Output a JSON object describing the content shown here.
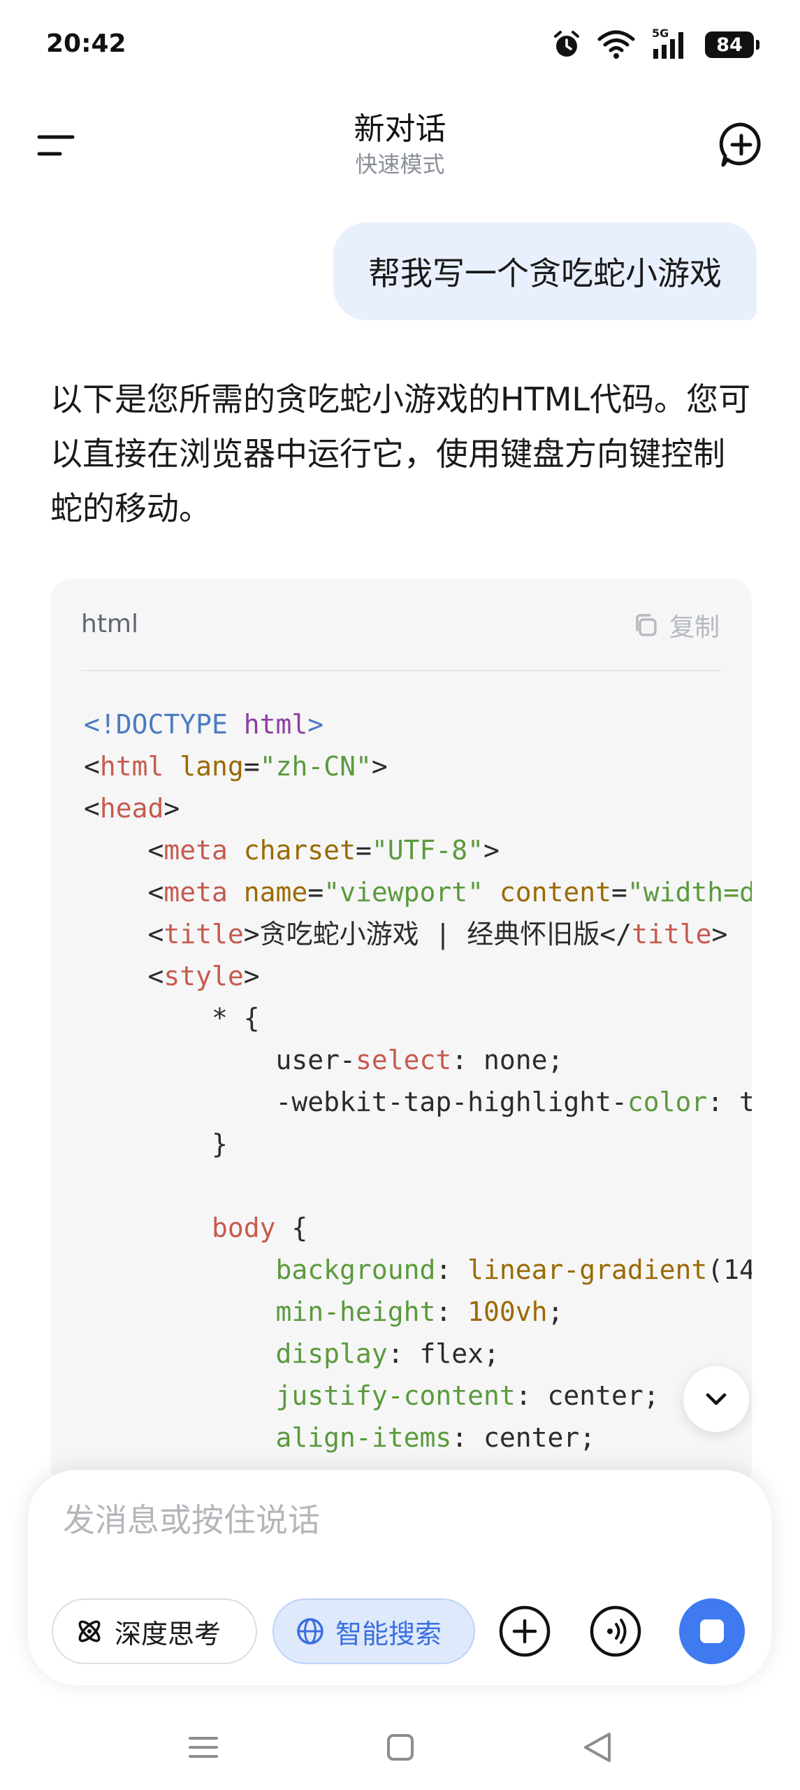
{
  "status_bar": {
    "time": "20:42",
    "network": "5G",
    "battery": "84"
  },
  "header": {
    "title": "新对话",
    "subtitle": "快速模式"
  },
  "chat": {
    "user_message": "帮我写一个贪吃蛇小游戏",
    "ai_message": "以下是您所需的贪吃蛇小游戏的HTML代码。您可以直接在浏览器中运行它，使用键盘方向键控制蛇的移动。"
  },
  "code_block": {
    "language": "html",
    "copy_label": "复制",
    "lines": [
      [
        [
          "<!DOCTYPE ",
          "doctype"
        ],
        [
          "html",
          "kw"
        ],
        [
          ">",
          "doctype"
        ]
      ],
      [
        [
          "<",
          "punc"
        ],
        [
          "html",
          "tag"
        ],
        [
          " ",
          "punc"
        ],
        [
          "lang",
          "attr"
        ],
        [
          "=",
          "punc"
        ],
        [
          "\"zh-CN\"",
          "str"
        ],
        [
          ">",
          "punc"
        ]
      ],
      [
        [
          "<",
          "punc"
        ],
        [
          "head",
          "tag"
        ],
        [
          ">",
          "punc"
        ]
      ],
      [
        [
          "    <",
          "punc"
        ],
        [
          "meta",
          "tag"
        ],
        [
          " ",
          "punc"
        ],
        [
          "charset",
          "attr"
        ],
        [
          "=",
          "punc"
        ],
        [
          "\"UTF-8\"",
          "str"
        ],
        [
          ">",
          "punc"
        ]
      ],
      [
        [
          "    <",
          "punc"
        ],
        [
          "meta",
          "tag"
        ],
        [
          " ",
          "punc"
        ],
        [
          "name",
          "attr"
        ],
        [
          "=",
          "punc"
        ],
        [
          "\"viewport\"",
          "str"
        ],
        [
          " ",
          "punc"
        ],
        [
          "content",
          "attr"
        ],
        [
          "=",
          "punc"
        ],
        [
          "\"width=d",
          "str"
        ]
      ],
      [
        [
          "    <",
          "punc"
        ],
        [
          "title",
          "tag"
        ],
        [
          ">贪吃蛇小游戏 | 经典怀旧版</",
          "text"
        ],
        [
          "title",
          "tag"
        ],
        [
          ">",
          "punc"
        ]
      ],
      [
        [
          "    <",
          "punc"
        ],
        [
          "style",
          "tag"
        ],
        [
          ">",
          "punc"
        ]
      ],
      [
        [
          "        * {",
          "text"
        ]
      ],
      [
        [
          "            user-",
          "text"
        ],
        [
          "select",
          "tag"
        ],
        [
          ": none;",
          "text"
        ]
      ],
      [
        [
          "            -webkit-tap-highlight-",
          "text"
        ],
        [
          "color",
          "prop"
        ],
        [
          ": t",
          "text"
        ]
      ],
      [
        [
          "        }",
          "text"
        ]
      ],
      [
        [
          "",
          "text"
        ]
      ],
      [
        [
          "        ",
          "text"
        ],
        [
          "body",
          "tag"
        ],
        [
          " {",
          "text"
        ]
      ],
      [
        [
          "            ",
          "text"
        ],
        [
          "background",
          "prop"
        ],
        [
          ": ",
          "text"
        ],
        [
          "linear-gradient",
          "val"
        ],
        [
          "(14",
          "text"
        ]
      ],
      [
        [
          "            ",
          "text"
        ],
        [
          "min-height",
          "prop"
        ],
        [
          ": ",
          "text"
        ],
        [
          "100vh",
          "val"
        ],
        [
          ";",
          "text"
        ]
      ],
      [
        [
          "            ",
          "text"
        ],
        [
          "display",
          "prop"
        ],
        [
          ": flex;",
          "text"
        ]
      ],
      [
        [
          "            ",
          "text"
        ],
        [
          "justify-content",
          "prop"
        ],
        [
          ": center;",
          "text"
        ]
      ],
      [
        [
          "            ",
          "text"
        ],
        [
          "align-items",
          "prop"
        ],
        [
          ": center;",
          "text"
        ]
      ]
    ]
  },
  "composer": {
    "placeholder": "发消息或按住说话",
    "deep_think_label": "深度思考",
    "smart_search_label": "智能搜索"
  },
  "colors": {
    "accent": "#3f7af0",
    "user_bubble": "#e9f0fd",
    "code_bg": "#f6f6f7"
  }
}
